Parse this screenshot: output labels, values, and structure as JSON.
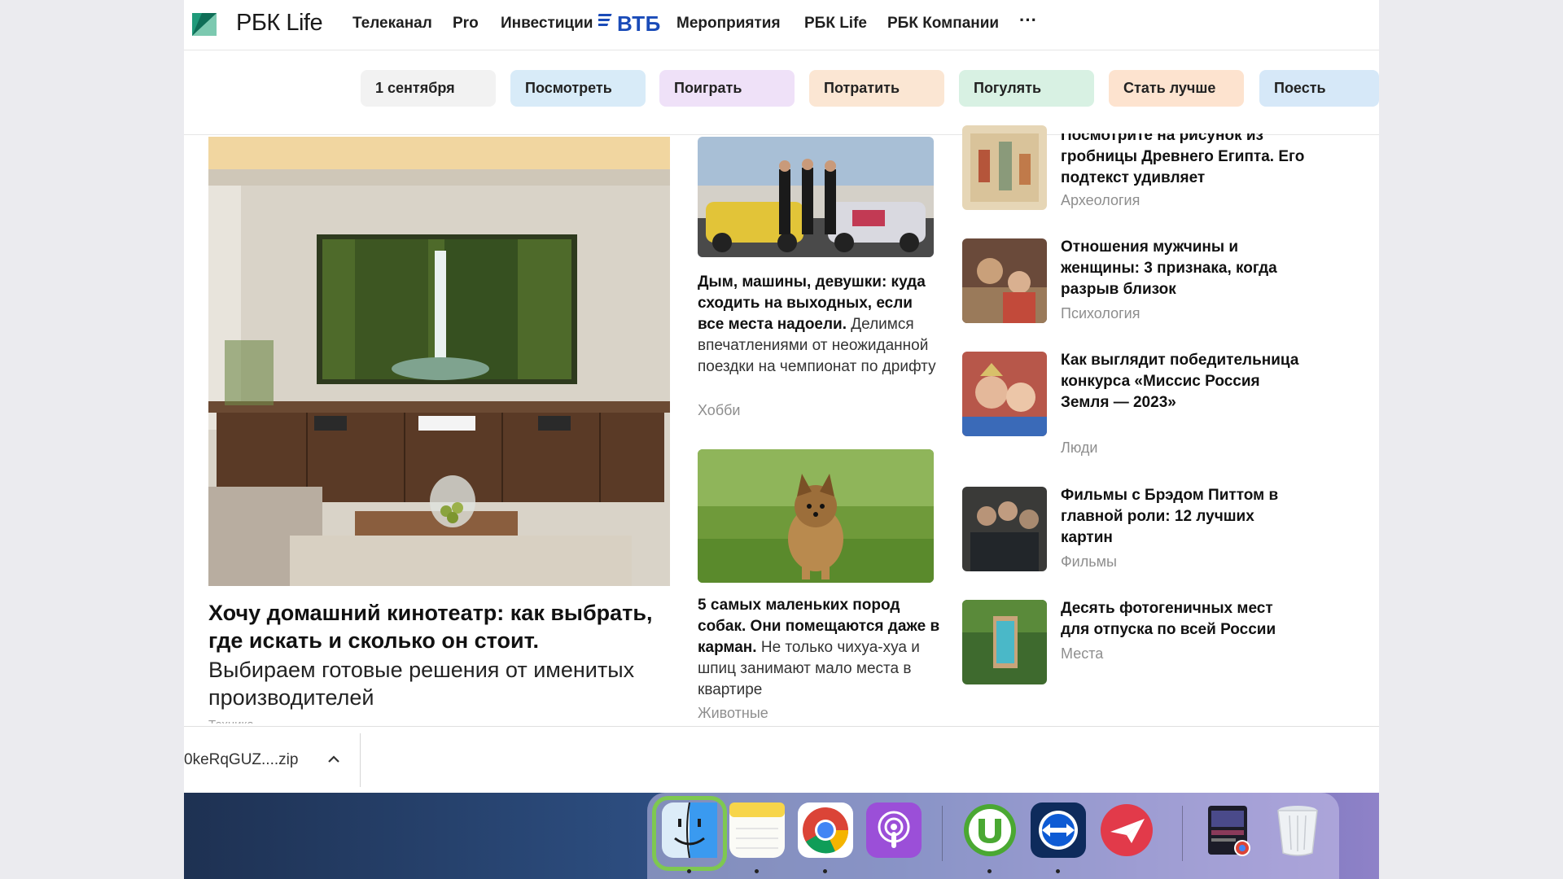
{
  "header": {
    "logo": "РБК Life",
    "nav": [
      "Телеканал",
      "Pro",
      "Инвестиции",
      "Мероприятия",
      "РБК Life",
      "РБК Компании"
    ],
    "partner": "ВТБ",
    "more": "···"
  },
  "pills": [
    {
      "label": "1 сентября",
      "color": "#f2f2f2"
    },
    {
      "label": "Посмотреть",
      "color": "#d8ebf8"
    },
    {
      "label": "Поиграть",
      "color": "#efe1f8"
    },
    {
      "label": "Потратить",
      "color": "#fbe6d3"
    },
    {
      "label": "Погулять",
      "color": "#d8f1e3"
    },
    {
      "label": "Стать лучше",
      "color": "#fde3cf"
    },
    {
      "label": "Поесть",
      "color": "#d6e8f8"
    }
  ],
  "hero": {
    "title": "Хочу домашний кинотеатр: как выбрать, где искать и сколько он стоит.",
    "subtitle": "Выбираем готовые решения от именитых производителей",
    "tag": "Техника"
  },
  "middle": [
    {
      "bold": "Дым, машины, девушки: куда сходить на выходных, если все места надоели.",
      "rest": " Делимся впечатлениями от неожиданной поездки на чемпионат по дрифту",
      "tag": "Хобби"
    },
    {
      "bold": "5 самых маленьких пород собак. Они помещаются даже в карман.",
      "rest": " Не только чихуа-хуа и шпиц занимают мало места в квартире",
      "tag": "Животные"
    }
  ],
  "right": [
    {
      "title": "Посмотрите на рисунок из гробницы Древнего Египта. Его подтекст удивляет",
      "tag": "Археология"
    },
    {
      "title": "Отношения мужчины и женщины: 3 признака, когда разрыв близок",
      "tag": "Психология"
    },
    {
      "title": "Как выглядит победительница конкурса «Миссис Россия Земля — 2023»",
      "tag": "Люди"
    },
    {
      "title": "Фильмы с Брэдом Питтом в главной роли: 12 лучших картин",
      "tag": "Фильмы"
    },
    {
      "title": "Десять фотогеничных мест для отпуска по всей России",
      "tag": "Места"
    }
  ],
  "download": {
    "filename": "0keRqGUZ....zip"
  },
  "dock": {
    "apps": [
      "finder-icon",
      "notes-icon",
      "chrome-icon",
      "podcasts-icon",
      "utorrent-icon",
      "teamviewer-icon",
      "airmail-icon",
      "screenshot-stack-icon",
      "trash-icon"
    ],
    "highlight_color": "#7ec850"
  }
}
